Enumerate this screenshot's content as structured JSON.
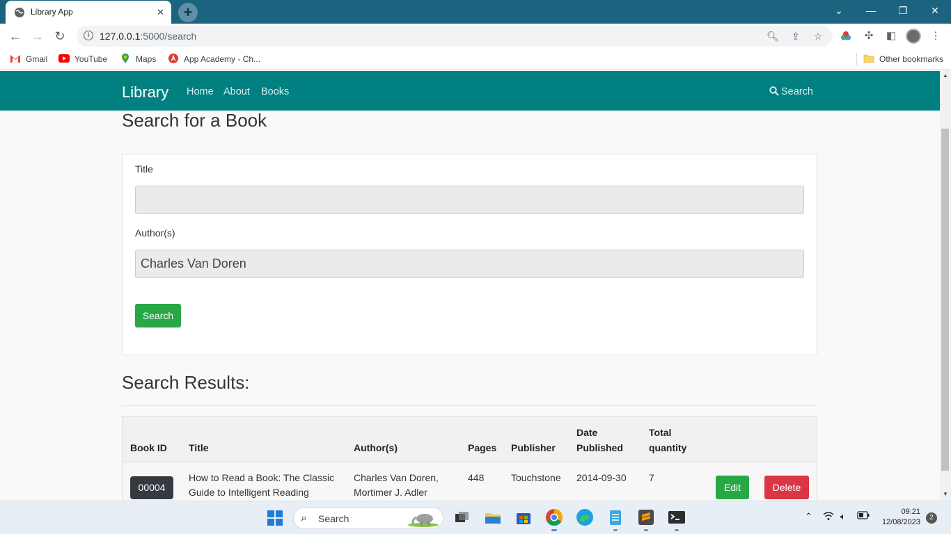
{
  "browser": {
    "tab_title": "Library App",
    "url_host": "127.0.0.1",
    "url_rest": ":5000/search",
    "bookmarks": [
      "Gmail",
      "YouTube",
      "Maps",
      "App Academy - Ch...",
      "Other bookmarks"
    ]
  },
  "navbar": {
    "brand": "Library",
    "links": [
      "Home",
      "About",
      "Books"
    ],
    "search_label": "Search"
  },
  "search_form": {
    "heading": "Search for a Book",
    "title_label": "Title",
    "title_value": "",
    "author_label": "Author(s)",
    "author_value": "Charles Van Doren",
    "submit_label": "Search"
  },
  "results": {
    "heading": "Search Results:",
    "columns": {
      "book_id": "Book ID",
      "title": "Title",
      "authors": "Author(s)",
      "pages": "Pages",
      "publisher": "Publisher",
      "date_line1": "Date",
      "date_line2": "Published",
      "qty_line1": "Total",
      "qty_line2": "quantity"
    },
    "rows": [
      {
        "book_id": "00004",
        "title_line1": "How to Read a Book: The Classic",
        "title_line2": "Guide to Intelligent Reading",
        "authors_line1": "Charles Van Doren,",
        "authors_line2": "Mortimer J. Adler",
        "pages": "448",
        "publisher": "Touchstone",
        "date_published": "2014-09-30",
        "total_quantity": "7",
        "edit_label": "Edit",
        "delete_label": "Delete"
      }
    ]
  },
  "taskbar": {
    "search_label": "Search",
    "time": "09:21",
    "date": "12/08/2023",
    "notifications": "2"
  },
  "colors": {
    "chrome_frame": "#1c6380",
    "navbar": "#008080",
    "success": "#28a745",
    "danger": "#dc3545",
    "badge": "#343a40"
  }
}
